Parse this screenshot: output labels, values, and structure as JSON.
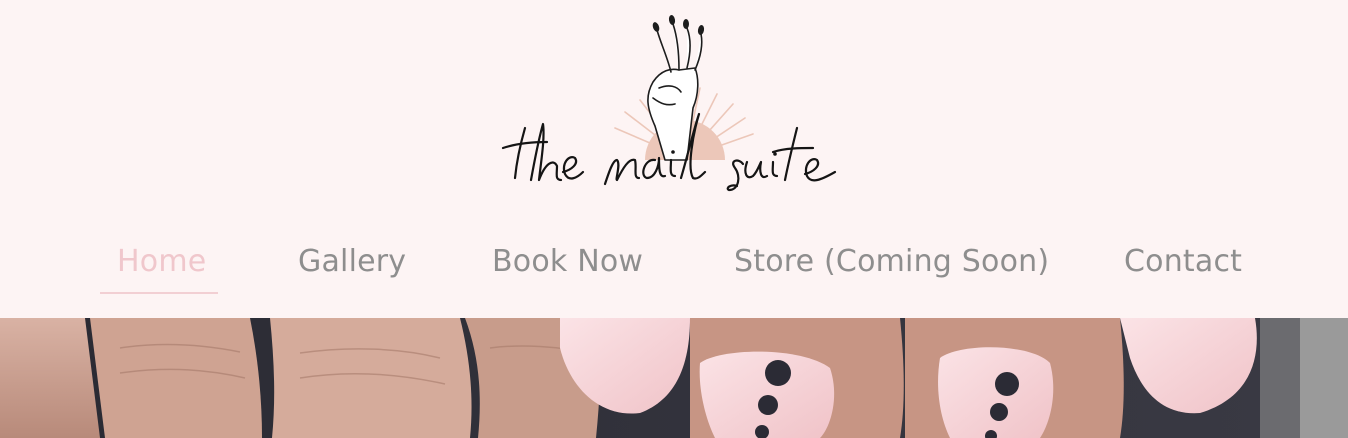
{
  "brand": {
    "logo_text": "the nail suite",
    "logo_icon": "hand-with-sun-icon"
  },
  "nav": {
    "items": [
      {
        "label": "Home",
        "active": true
      },
      {
        "label": "Gallery",
        "active": false
      },
      {
        "label": "Book Now",
        "active": false
      },
      {
        "label": "Store (Coming Soon)",
        "active": false
      },
      {
        "label": "Contact",
        "active": false
      }
    ]
  },
  "colors": {
    "background": "#fdf4f4",
    "nav_text": "#8e8e8e",
    "nav_active": "#f0c7cc",
    "logo_sun": "#ecc7b9"
  }
}
